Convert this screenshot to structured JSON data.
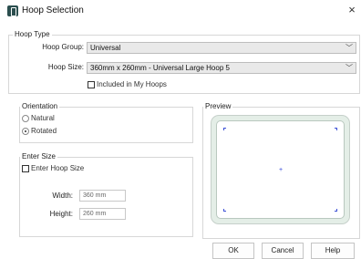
{
  "window": {
    "title": "Hoop Selection",
    "close_glyph": "×"
  },
  "hoop_type": {
    "legend": "Hoop Type",
    "group_label": "Hoop Group:",
    "group_value": "Universal",
    "size_label": "Hoop Size:",
    "size_value": "360mm x 260mm - Universal Large Hoop 5",
    "my_hoops_label": "Included in My Hoops",
    "my_hoops_checked": false
  },
  "orientation": {
    "legend": "Orientation",
    "options": [
      {
        "label": "Natural",
        "checked": false
      },
      {
        "label": "Rotated",
        "checked": true
      }
    ]
  },
  "enter_size": {
    "legend": "Enter Size",
    "checkbox_label": "Enter Hoop Size",
    "checked": false,
    "width_label": "Width:",
    "width_value": "360 mm",
    "height_label": "Height:",
    "height_value": "260 mm"
  },
  "preview": {
    "legend": "Preview"
  },
  "buttons": {
    "ok": "OK",
    "cancel": "Cancel",
    "help": "Help"
  },
  "colors": {
    "accent_blue": "#2d41d8",
    "hoop_green": "#e4eee7",
    "app_icon": "#2b4e4e"
  }
}
